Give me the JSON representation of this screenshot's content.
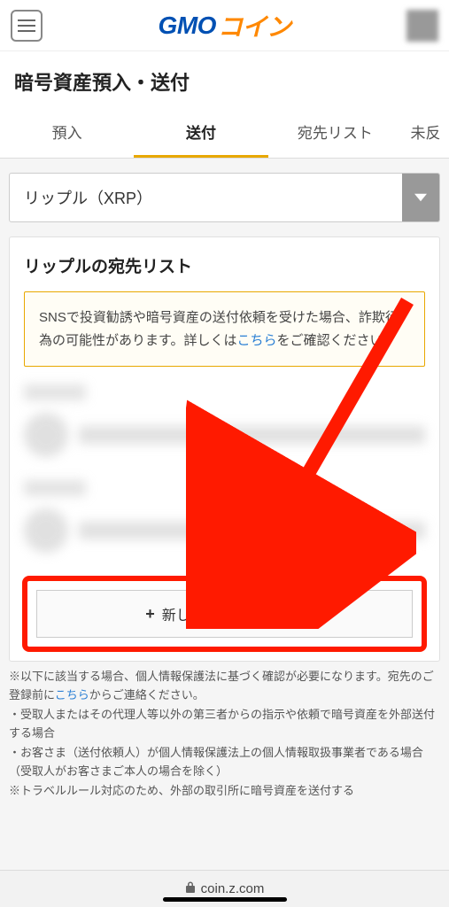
{
  "header": {
    "logo_gmo": "GMO",
    "logo_coin": "コイン"
  },
  "page_title": "暗号資産預入・送付",
  "tabs": {
    "deposit": "預入",
    "send": "送付",
    "recipients": "宛先リスト",
    "partial": "未反"
  },
  "asset_select": {
    "selected": "リップル（XRP）"
  },
  "card": {
    "title": "リップルの宛先リスト",
    "notice_pre": "SNSで投資勧誘や暗号資産の送付依頼を受けた場合、詐欺行為の可能性があります。詳しくは",
    "notice_link": "こちら",
    "notice_post": "をご確認ください。"
  },
  "add_button": {
    "plus": "+",
    "label": "新しい宛先を追加する"
  },
  "disclaimer": {
    "line1_pre": "※以下に該当する場合、個人情報保護法に基づく確認が必要になります。宛先のご登録前に",
    "line1_link": "こちら",
    "line1_post": "からご連絡ください。",
    "line2": "・受取人またはその代理人等以外の第三者からの指示や依頼で暗号資産を外部送付する場合",
    "line3": "・お客さま（送付依頼人）が個人情報保護法上の個人情報取扱事業者である場合（受取人がお客さまご本人の場合を除く）",
    "line4": "※トラベルルール対応のため、外部の取引所に暗号資産を送付する"
  },
  "url_bar": {
    "domain": "coin.z.com"
  }
}
